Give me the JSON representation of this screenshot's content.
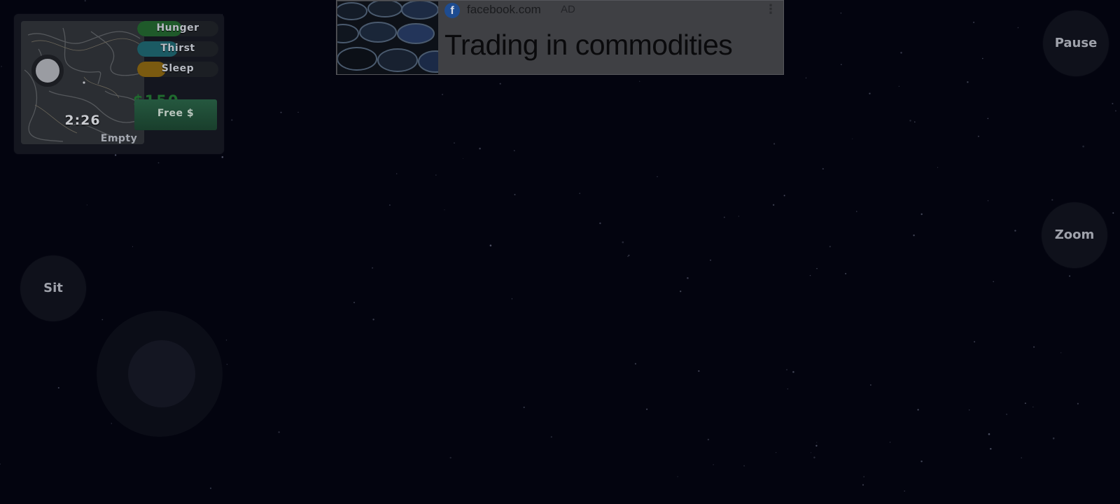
{
  "hud": {
    "minimap_time": "2:26",
    "stats": [
      {
        "label": "Hunger",
        "level": 0.55,
        "color": "#1f5a2a"
      },
      {
        "label": "Thirst",
        "level": 0.5,
        "color": "#1b5a63"
      },
      {
        "label": "Sleep",
        "level": 0.35,
        "color": "#7a5a10"
      }
    ],
    "money": "$150",
    "free_money_button": "Free $",
    "inventory_status": "Empty"
  },
  "ad": {
    "icon": "facebook-icon",
    "domain": "facebook.com",
    "tag": "AD",
    "more_icon": "⋮",
    "headline": "Trading in commodities"
  },
  "controls": {
    "pause_label": "Pause",
    "zoom_label": "Zoom",
    "sit_label": "Sit"
  },
  "colors": {
    "background": "#03040f",
    "money": "#1f6b2e",
    "free_button": "#25583f"
  }
}
